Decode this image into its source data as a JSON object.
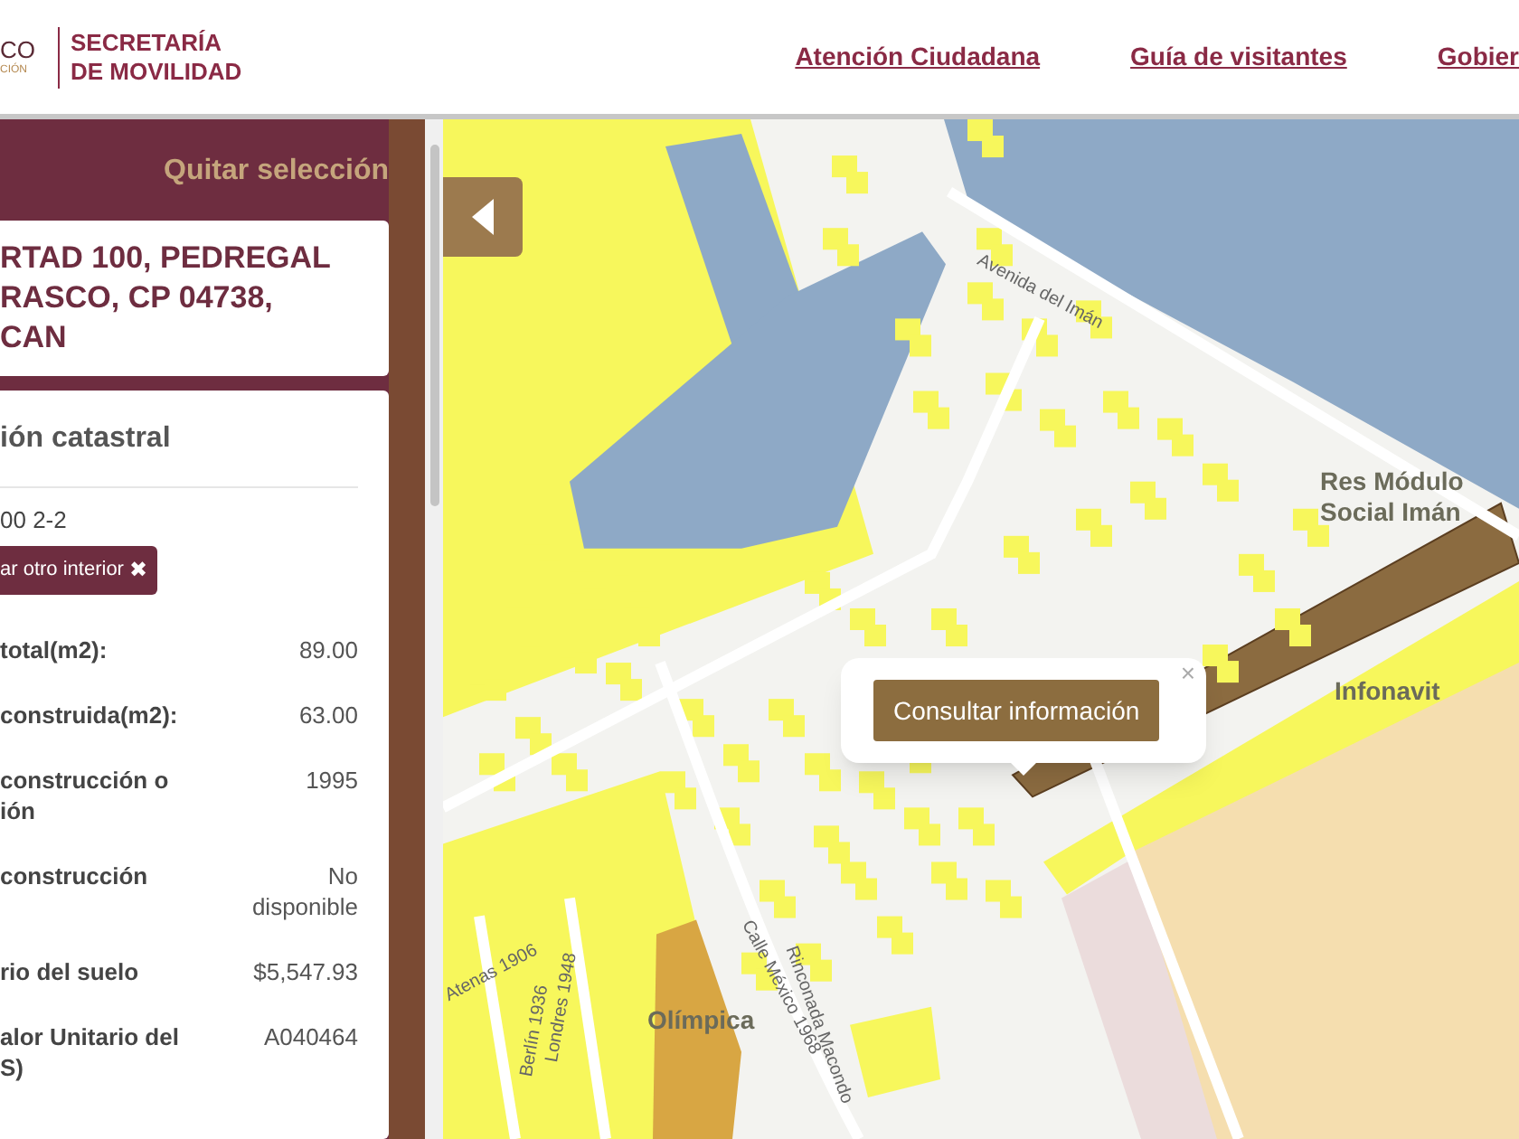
{
  "header": {
    "logo_text": "CO",
    "logo_subtext": "CIÓN",
    "agency_lines": [
      "SECRETARÍA",
      "DE MOVILIDAD"
    ],
    "nav_links": [
      "Atención Ciudadana",
      "Guía de visitantes",
      "Gobier"
    ]
  },
  "sidebar": {
    "clear_selection": "Quitar selección",
    "address_lines": [
      "RTAD 100, PEDREGAL",
      "RASCO, CP 04738,",
      "CAN"
    ],
    "cadastral_card": {
      "title": "ión catastral",
      "account": "00 2-2",
      "change_button": "ar otro interior",
      "change_button_icon": "✖",
      "rows": [
        {
          "label": "total(m2):",
          "value": "89.00"
        },
        {
          "label": "construida(m2):",
          "value": "63.00"
        },
        {
          "label": "construcción o\nión",
          "value": "1995"
        },
        {
          "label": "construcción",
          "value": "No\ndisponible"
        },
        {
          "label": "rio del suelo",
          "value": "$5,547.93"
        },
        {
          "label": "alor Unitario del\nS)",
          "value": "A040464"
        }
      ]
    }
  },
  "map": {
    "popup": {
      "button": "Consultar información",
      "close": "×"
    },
    "labels": [
      {
        "text": "Avenida del Imán",
        "kind": "street"
      },
      {
        "text": "Res Módulo\nSocial Imán",
        "kind": "place"
      },
      {
        "text": "Infonavit",
        "kind": "place"
      },
      {
        "text": "Olímpica",
        "kind": "place"
      },
      {
        "text": "Calle México 1968",
        "kind": "street"
      },
      {
        "text": "Rinconada Macondo",
        "kind": "street"
      },
      {
        "text": "Atenas 1906",
        "kind": "street"
      },
      {
        "text": "Berlín 1936",
        "kind": "street"
      },
      {
        "text": "Londres 1948",
        "kind": "street"
      }
    ]
  }
}
